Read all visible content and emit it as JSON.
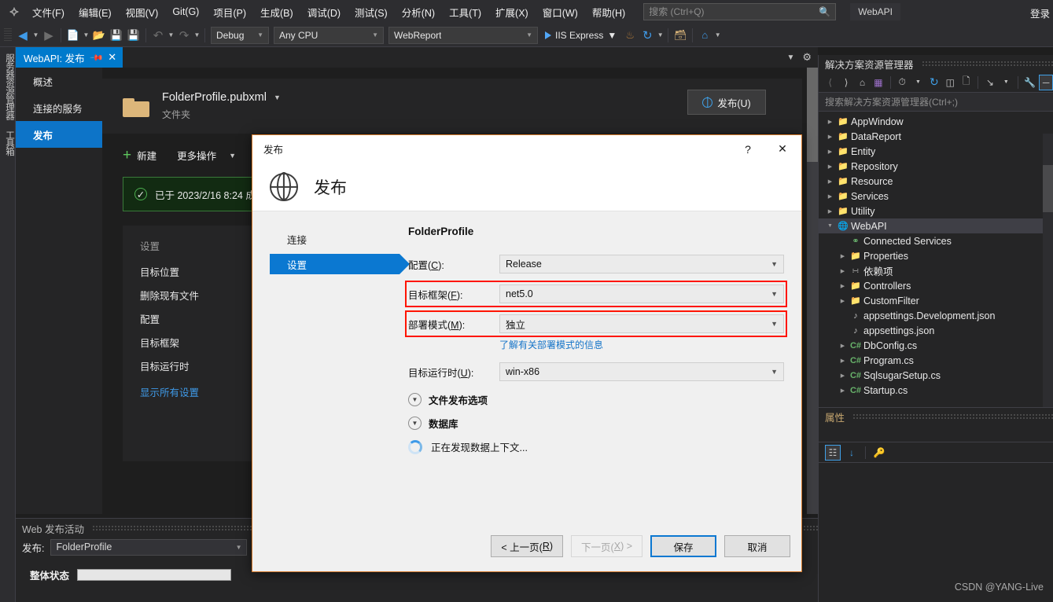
{
  "menubar": {
    "logo": "vs-logo-icon",
    "items": [
      "文件(F)",
      "编辑(E)",
      "视图(V)",
      "Git(G)",
      "项目(P)",
      "生成(B)",
      "调试(D)",
      "测试(S)",
      "分析(N)",
      "工具(T)",
      "扩展(X)",
      "窗口(W)",
      "帮助(H)"
    ],
    "search_placeholder": "搜索 (Ctrl+Q)",
    "search_value": "",
    "project_badge": "WebAPI",
    "signin": "登录"
  },
  "toolbar": {
    "configuration": "Debug",
    "platform": "Any CPU",
    "startup_project": "WebReport",
    "run_label": "IIS Express"
  },
  "leftdock": {
    "items": [
      "服务器资源管理器",
      "工具箱"
    ]
  },
  "tabstrip": {
    "active_tab": "WebAPI: 发布"
  },
  "publish_doc": {
    "nav": [
      {
        "label": "概述",
        "selected": false
      },
      {
        "label": "连接的服务",
        "selected": false
      },
      {
        "label": "发布",
        "selected": true
      }
    ],
    "profile_name": "FolderProfile.pubxml",
    "profile_kind": "文件夹",
    "publish_button": "发布(U)",
    "new_label": "新建",
    "more_label": "更多操作",
    "success_text": "已于 2023/2/16 8:24 成",
    "settings_head": "设置",
    "settings_items": [
      "目标位置",
      "删除现有文件",
      "配置",
      "目标框架",
      "目标运行时"
    ],
    "show_all": "显示所有设置"
  },
  "bottom_panel": {
    "title": "Web 发布活动",
    "publish_label": "发布:",
    "profile": "FolderProfile",
    "overall_status_label": "整体状态"
  },
  "solution_explorer": {
    "title": "解决方案资源管理器",
    "search_placeholder": "搜索解决方案资源管理器(Ctrl+;)",
    "toolbar_icons": [
      "back-icon",
      "forward-icon",
      "home-icon",
      "solution-view-icon",
      "pending-changes-icon",
      "refresh-icon",
      "collapse-all-icon",
      "show-all-files-icon",
      "sync-icon",
      "properties-wrench-icon",
      "minimize-icon"
    ],
    "tree": [
      {
        "label": "AppWindow",
        "icon": "folder-icon",
        "indent": 0,
        "expander": "collapsed",
        "selected": false
      },
      {
        "label": "DataReport",
        "icon": "folder-icon",
        "indent": 0,
        "expander": "collapsed",
        "selected": false
      },
      {
        "label": "Entity",
        "icon": "folder-icon",
        "indent": 0,
        "expander": "collapsed",
        "selected": false
      },
      {
        "label": "Repository",
        "icon": "folder-icon",
        "indent": 0,
        "expander": "collapsed",
        "selected": false
      },
      {
        "label": "Resource",
        "icon": "folder-icon",
        "indent": 0,
        "expander": "collapsed",
        "selected": false
      },
      {
        "label": "Services",
        "icon": "folder-icon",
        "indent": 0,
        "expander": "collapsed",
        "selected": false
      },
      {
        "label": "Utility",
        "icon": "folder-icon",
        "indent": 0,
        "expander": "collapsed",
        "selected": false
      },
      {
        "label": "WebAPI",
        "icon": "web-project-icon",
        "indent": 0,
        "expander": "expanded",
        "selected": true
      },
      {
        "label": "Connected Services",
        "icon": "connected-services-icon",
        "indent": 1,
        "expander": "none",
        "selected": false
      },
      {
        "label": "Properties",
        "icon": "properties-folder-icon",
        "indent": 1,
        "expander": "collapsed",
        "selected": false
      },
      {
        "label": "依赖项",
        "icon": "dependencies-icon",
        "indent": 1,
        "expander": "collapsed",
        "selected": false
      },
      {
        "label": "Controllers",
        "icon": "folder-icon",
        "indent": 1,
        "expander": "collapsed",
        "selected": false
      },
      {
        "label": "CustomFilter",
        "icon": "folder-icon",
        "indent": 1,
        "expander": "collapsed",
        "selected": false
      },
      {
        "label": "appsettings.Development.json",
        "icon": "json-file-icon",
        "indent": 1,
        "expander": "none",
        "selected": false
      },
      {
        "label": "appsettings.json",
        "icon": "json-file-icon",
        "indent": 1,
        "expander": "none",
        "selected": false
      },
      {
        "label": "DbConfig.cs",
        "icon": "csharp-file-icon",
        "indent": 1,
        "expander": "collapsed",
        "selected": false
      },
      {
        "label": "Program.cs",
        "icon": "csharp-file-icon",
        "indent": 1,
        "expander": "collapsed",
        "selected": false
      },
      {
        "label": "SqlsugarSetup.cs",
        "icon": "csharp-file-icon",
        "indent": 1,
        "expander": "collapsed",
        "selected": false
      },
      {
        "label": "Startup.cs",
        "icon": "csharp-file-icon",
        "indent": 1,
        "expander": "collapsed",
        "selected": false
      }
    ]
  },
  "properties_panel": {
    "title": "属性",
    "toolbar_icons": [
      "categorized-icon",
      "alphabetical-icon",
      "property-pages-icon"
    ]
  },
  "dialog": {
    "titlebar": "发布",
    "help_glyph": "?",
    "close_glyph": "✕",
    "header": "发布",
    "nav": [
      {
        "label": "连接",
        "selected": false
      },
      {
        "label": "设置",
        "selected": true
      }
    ],
    "form_title": "FolderProfile",
    "fields": [
      {
        "label": "配置(C):",
        "mnemonic": "C",
        "value": "Release",
        "highlight": false
      },
      {
        "label": "目标框架(F):",
        "mnemonic": "F",
        "value": "net5.0",
        "highlight": true
      },
      {
        "label": "部署模式(M):",
        "mnemonic": "M",
        "value": "独立",
        "highlight": true
      },
      {
        "label": "目标运行时(U):",
        "mnemonic": "U",
        "value": "win-x86",
        "highlight": false
      }
    ],
    "link": "了解有关部署模式的信息",
    "sections": [
      "文件发布选项",
      "数据库"
    ],
    "status": "正在发现数据上下文...",
    "buttons": [
      {
        "label": "< 上一页(R)",
        "state": "normal"
      },
      {
        "label": "下一页(X) >",
        "state": "disabled"
      },
      {
        "label": "保存",
        "state": "primary"
      },
      {
        "label": "取消",
        "state": "normal"
      }
    ]
  },
  "watermark": "CSDN @YANG-Live",
  "colors": {
    "accent": "#007acc",
    "dialog_accent": "#0b78d1",
    "highlight_red": "#ff1500",
    "success_green": "#4caf50",
    "dialog_border_orange": "#d5792a"
  }
}
